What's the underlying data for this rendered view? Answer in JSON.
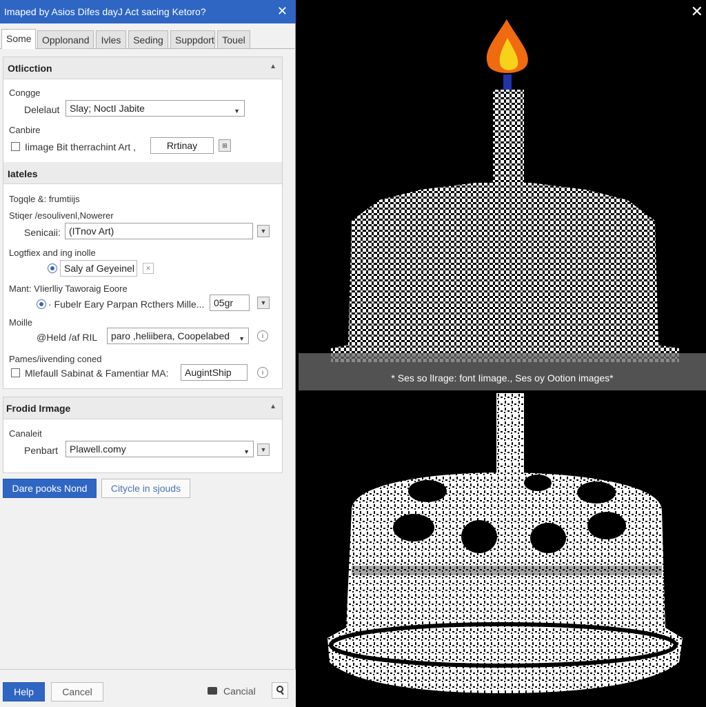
{
  "dialog": {
    "title": "Imaped by Asios Difes dayJ Act sacing Ketoro?",
    "close_glyph": "✕"
  },
  "tabs": [
    {
      "label": "Some",
      "active": true
    },
    {
      "label": "Opplonand",
      "active": false
    },
    {
      "label": "Ivles",
      "active": false
    },
    {
      "label": "Seding",
      "active": false
    },
    {
      "label": "Suppdort",
      "active": false
    },
    {
      "label": "Touel",
      "active": false
    }
  ],
  "section1": {
    "title": "Otlicction",
    "collapse_glyph": "▲",
    "congge_label": "Congge",
    "deleaut_label": "Delelaut",
    "deleaut_value": "Slay; NoctI Jabite",
    "canbire_label": "Canbire",
    "checkbox_label": "Iimage Bit therrachint Art ,",
    "rrtinay_value": "Rrtinay",
    "small_icon_glyph": "⊞"
  },
  "section2": {
    "title": "Iateles",
    "togqle_label": "Togqle &: frumtiijs",
    "stiqer_label": "Stiqer /esoulivenl,Nowerer",
    "senicaii_label": "Senicaii:",
    "senicaii_value": "(ITnov Art)",
    "logtfiex_label": "Logtfiex and ing inolle",
    "radio1_label": "Saly af Geyeinel",
    "mant_label": "Mant: VIierlliy Taworaig Eoore",
    "radio2_label": "· Fubelr Eary Parpan Rcthers Mille...",
    "radio2_value": "05gr",
    "moille_label": "Moille",
    "held_label": "@Held /af RIL",
    "held_value": "paro ,heliibera, Coopelabed",
    "pames_label": "Pames/iivending coned",
    "check2_label": "Mlefaull Sabinat & Famentiar MA:",
    "check2_value": "AugintShip",
    "info_glyph": "i"
  },
  "section3": {
    "title": "Frodid Irmage",
    "collapse_glyph": "▲",
    "canaleit_label": "Canaleit",
    "penbart_label": "Penbart",
    "penbart_value": "Plawell.comy"
  },
  "actions": {
    "primary_label": "Dare pooks Nond",
    "secondary_label": "Citycle in sjouds"
  },
  "footer": {
    "help_label": "Help",
    "cancel_label": "Cancel",
    "cancial_label": "Cancial"
  },
  "preview": {
    "banner_text": "* Ses so lIrage: font Iimage., Ses oy Ootion images*",
    "close_glyph": "✕"
  },
  "colors": {
    "accent": "#2f66c3",
    "flame_outer": "#f06a10",
    "flame_inner": "#f7d21a"
  }
}
